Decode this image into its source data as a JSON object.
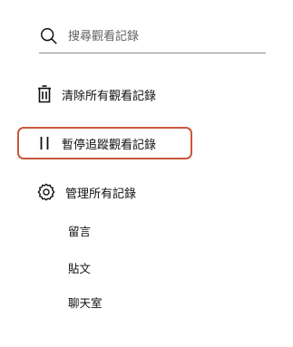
{
  "search": {
    "placeholder": "搜尋觀看記錄",
    "icon": "search-icon"
  },
  "actions": {
    "clear_all": {
      "label": "清除所有觀看記錄",
      "icon": "trash-icon"
    },
    "pause": {
      "label": "暫停追蹤觀看記錄",
      "icon": "pause-icon"
    },
    "manage": {
      "label": "管理所有記錄",
      "icon": "gear-icon"
    }
  },
  "manage_items": [
    {
      "label": "留言"
    },
    {
      "label": "貼文"
    },
    {
      "label": "聊天室"
    }
  ],
  "colors": {
    "highlight": "#c9573a",
    "text": "#0f0f0f",
    "placeholder": "#606060"
  }
}
